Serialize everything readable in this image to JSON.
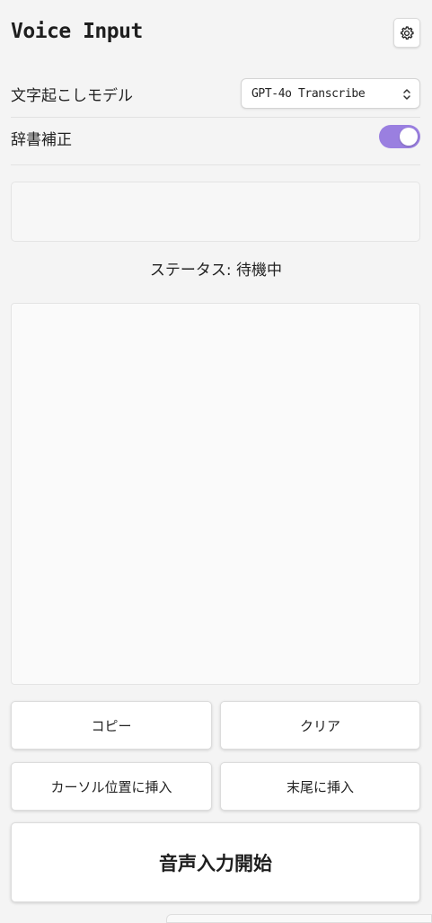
{
  "header": {
    "title": "Voice Input",
    "settings_icon": "gear-icon"
  },
  "settings": {
    "model_label": "文字起こしモデル",
    "model_selected": "GPT-4o Transcribe",
    "dictionary_label": "辞書補正",
    "dictionary_enabled": true
  },
  "status": {
    "text": "ステータス: 待機中"
  },
  "transcript": {
    "text": ""
  },
  "actions": {
    "copy_label": "コピー",
    "clear_label": "クリア",
    "insert_cursor_label": "カーソル位置に挿入",
    "insert_end_label": "末尾に挿入",
    "start_label": "音声入力開始"
  },
  "colors": {
    "accent": "#9a7fe0",
    "background": "#f4f4f4"
  }
}
